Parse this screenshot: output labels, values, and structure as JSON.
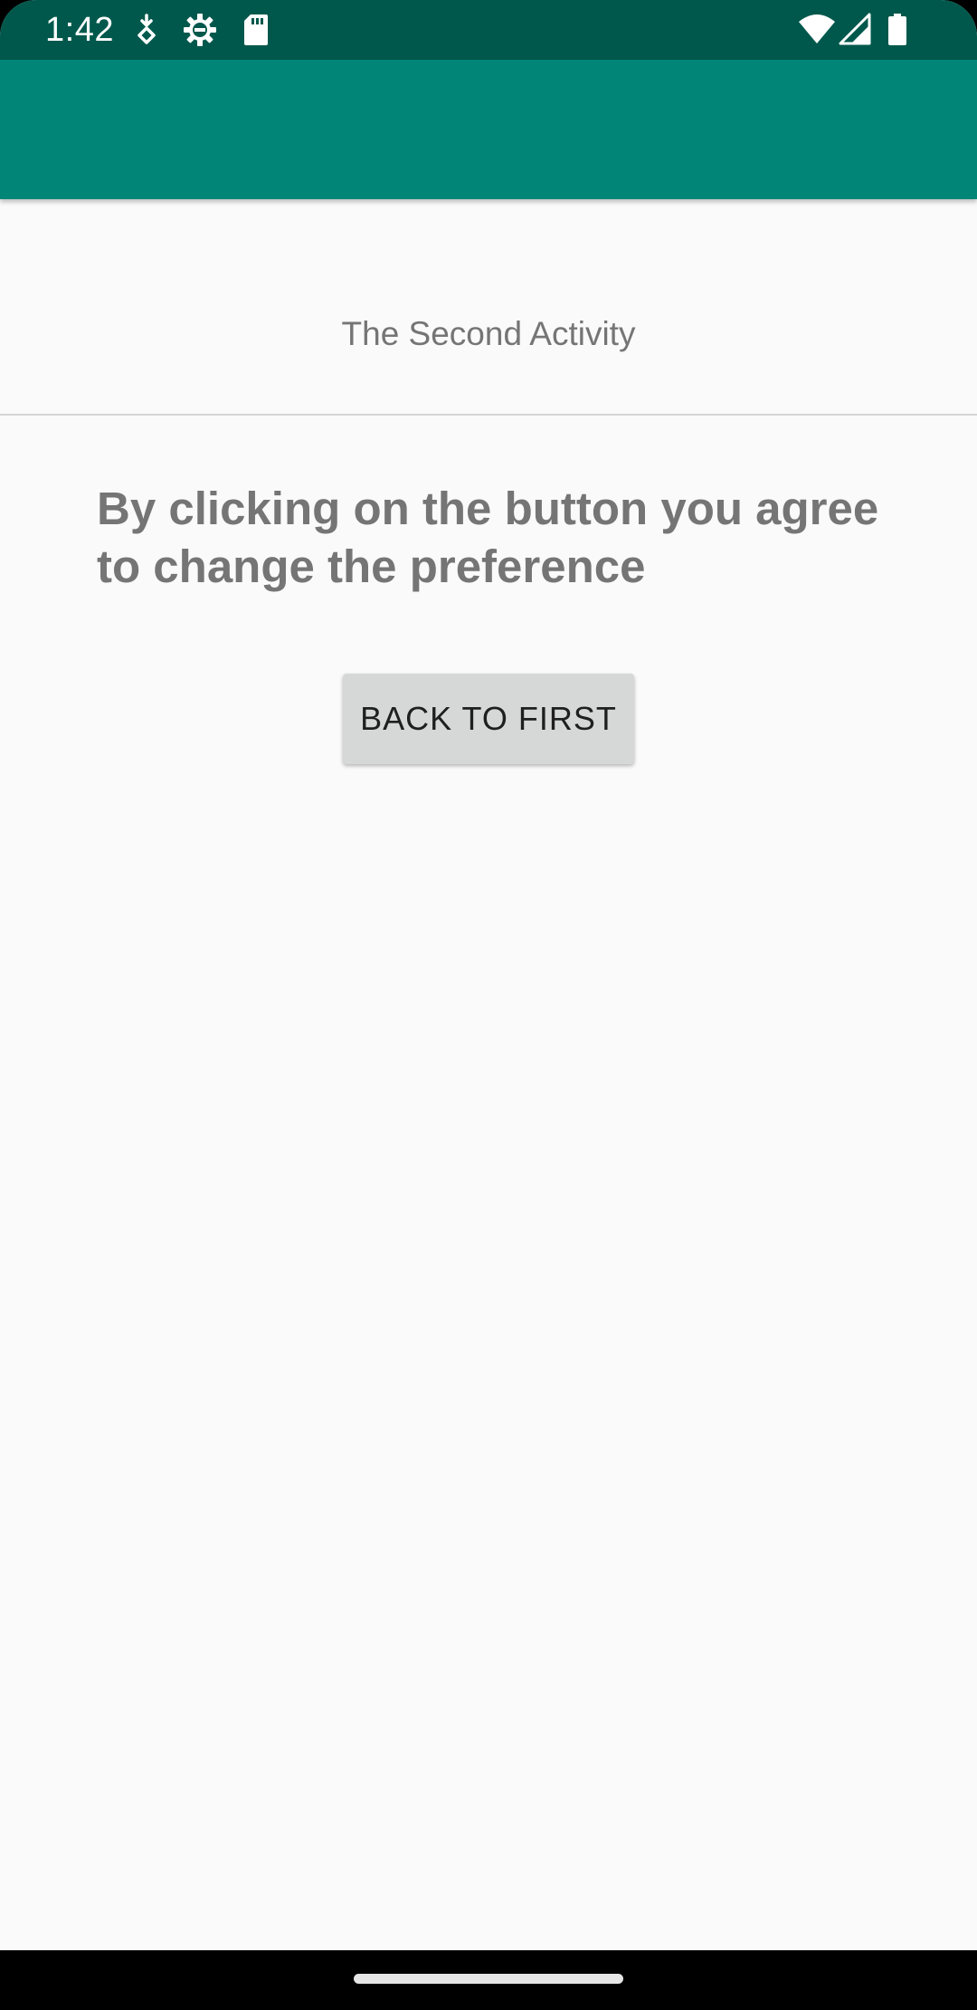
{
  "status_bar": {
    "time": "1:42",
    "left_icons": [
      "download-status-icon",
      "settings-gear-icon",
      "sd-card-icon"
    ],
    "right_icons": [
      "wifi-icon",
      "cellular-signal-icon",
      "battery-icon"
    ],
    "background_color": "#00584c"
  },
  "app_bar": {
    "title": "",
    "background_color": "#008577"
  },
  "content": {
    "subtitle": "The Second Activity",
    "message": "By clicking on the button you agree to change the preference",
    "button_label": "BACK TO FIRST"
  },
  "nav_bar": {
    "home_indicator": "home-pill"
  }
}
